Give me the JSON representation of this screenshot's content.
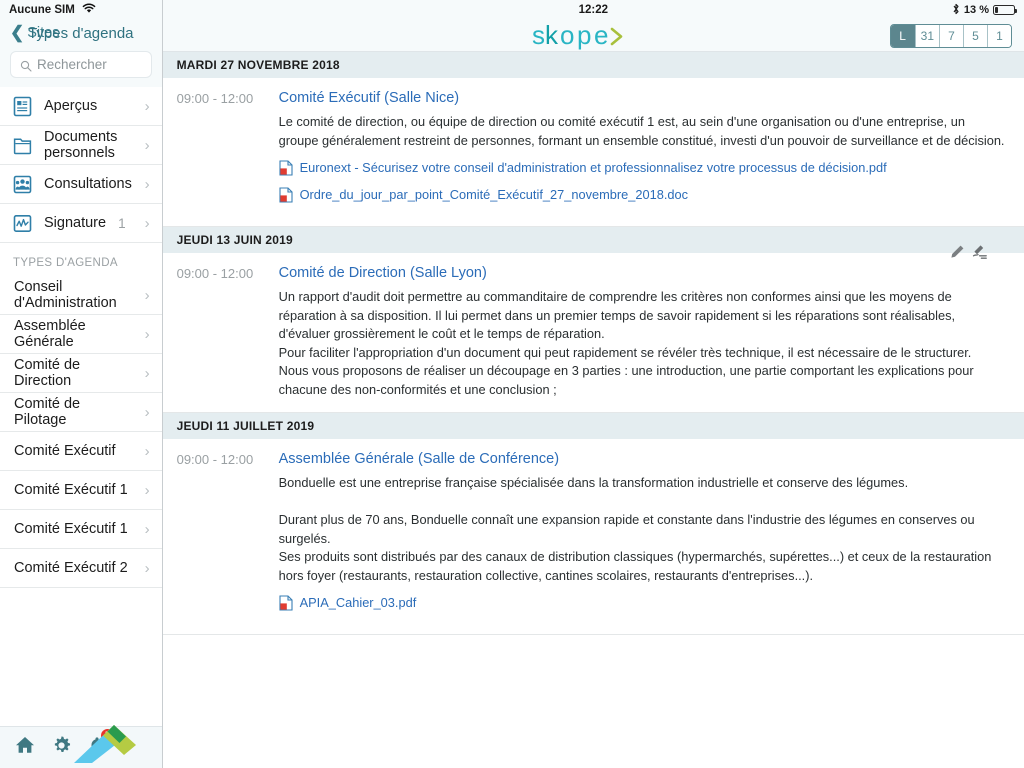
{
  "status_bar": {
    "carrier": "Aucune SIM",
    "wifi_icon": "wifi-icon",
    "time": "12:22",
    "bluetooth_icon": "bluetooth-icon",
    "battery_percent": "13 %",
    "battery_icon": "battery-icon"
  },
  "sidebar": {
    "back_label": "Sites",
    "back_icon": "chevron-left-icon",
    "title": "Types d'agenda",
    "search": {
      "placeholder": "Rechercher",
      "value": "",
      "icon": "search-icon"
    },
    "primary_items": [
      {
        "label": "Apercus",
        "label_fr": "Aperçus",
        "icon": "document-icon",
        "count": "",
        "chevron": "›"
      },
      {
        "label": "Documents personnels",
        "icon": "folder-icon",
        "count": "",
        "chevron": "›"
      },
      {
        "label": "Consultations",
        "icon": "group-icon",
        "count": "",
        "chevron": "›"
      },
      {
        "label": "Signature",
        "icon": "signature-icon",
        "count": "1",
        "chevron": "›"
      }
    ],
    "section_header": "TYPES D'AGENDA",
    "agenda_types": [
      {
        "label": "Conseil d'Administration",
        "chevron": "›"
      },
      {
        "label": "Assemblée Générale",
        "chevron": "›"
      },
      {
        "label": "Comité de Direction",
        "chevron": "›"
      },
      {
        "label": "Comité de Pilotage",
        "chevron": "›"
      },
      {
        "label": "Comité Exécutif",
        "chevron": "›"
      },
      {
        "label": "Comité Exécutif 1",
        "chevron": "›"
      },
      {
        "label": "Comité Exécutif 1",
        "chevron": "›"
      },
      {
        "label": "Comité Exécutif 2",
        "chevron": "›"
      }
    ],
    "toolbar": {
      "home_icon": "home-icon",
      "settings_icon": "gear-icon",
      "notifications_icon": "bell-icon",
      "notifications_badge": "5",
      "corner_logo_icon": "chevron-logo-icon"
    }
  },
  "header": {
    "brand": "skope",
    "brand_chevron": "›",
    "view_segments": [
      {
        "label": "L",
        "selected": true
      },
      {
        "label": "31",
        "selected": false
      },
      {
        "label": "7",
        "selected": false
      },
      {
        "label": "5",
        "selected": false
      },
      {
        "label": "1",
        "selected": false
      }
    ]
  },
  "colors": {
    "brand_cyan": "#29b5c4",
    "brand_teal": "#12a0a8",
    "brand_green": "#a8c03c",
    "link_blue": "#2b6cb8",
    "day_header_bg": "#e4edf0",
    "segment_selected_bg": "#5c868e",
    "badge_red": "#e8342a",
    "logo_sky": "#5bc8ec",
    "logo_green": "#2a9b4e",
    "logo_lime": "#b5cb43"
  },
  "agenda": {
    "days": [
      {
        "date_label": "MARDI 27 NOVEMBRE 2018",
        "events": [
          {
            "time": "09:00 - 12:00",
            "title": "Comité Exécutif (Salle Nice)",
            "description": "Le comité de direction, ou équipe de direction ou comité exécutif 1 est, au sein d'une organisation ou d'une entreprise, un groupe généralement restreint de personnes, formant un ensemble constitué, investi d'un pouvoir de surveillance et de décision.",
            "has_actions": true,
            "edit_icon": "pencil-icon",
            "sign_icon": "signature-pen-icon",
            "attachments": [
              {
                "name": "Euronext - Sécurisez votre conseil d'administration et professionnalisez votre processus de décision.pdf",
                "icon": "pdf-file-icon"
              },
              {
                "name": "Ordre_du_jour_par_point_Comité_Exécutif_27_novembre_2018.doc",
                "icon": "doc-file-icon"
              }
            ]
          }
        ]
      },
      {
        "date_label": "JEUDI 13 JUIN 2019",
        "events": [
          {
            "time": "09:00 - 12:00",
            "title": "Comité de Direction (Salle Lyon)",
            "description": "Un rapport d'audit doit permettre au commanditaire de comprendre les critères non conformes ainsi que les moyens de réparation à sa disposition. Il lui permet dans un premier temps de savoir rapidement si les réparations sont réalisables, d'évaluer grossièrement le coût et le temps de réparation.\nPour faciliter l'appropriation d'un document qui peut rapidement se révéler très technique, il est nécessaire de le structurer.\nNous vous proposons de réaliser un découpage en 3 parties : une introduction, une partie comportant les explications pour chacune des non-conformités et une conclusion ;",
            "has_actions": false,
            "attachments": []
          }
        ]
      },
      {
        "date_label": "JEUDI 11 JUILLET 2019",
        "events": [
          {
            "time": "09:00 - 12:00",
            "title": "Assemblée Générale (Salle de Conférence)",
            "description": "Bonduelle est une entreprise française spécialisée dans la transformation industrielle et conserve des légumes.\n\nDurant plus de 70 ans, Bonduelle connaît une expansion rapide et constante dans l'industrie des légumes en conserves ou surgelés.\n Ses produits sont distribués par des canaux de distribution classiques (hypermarchés, supérettes...) et ceux de la restauration hors foyer (restaurants, restauration collective, cantines scolaires, restaurants d'entreprises...).",
            "has_actions": false,
            "attachments": [
              {
                "name": "APIA_Cahier_03.pdf",
                "icon": "pdf-file-icon"
              }
            ]
          }
        ]
      }
    ]
  }
}
